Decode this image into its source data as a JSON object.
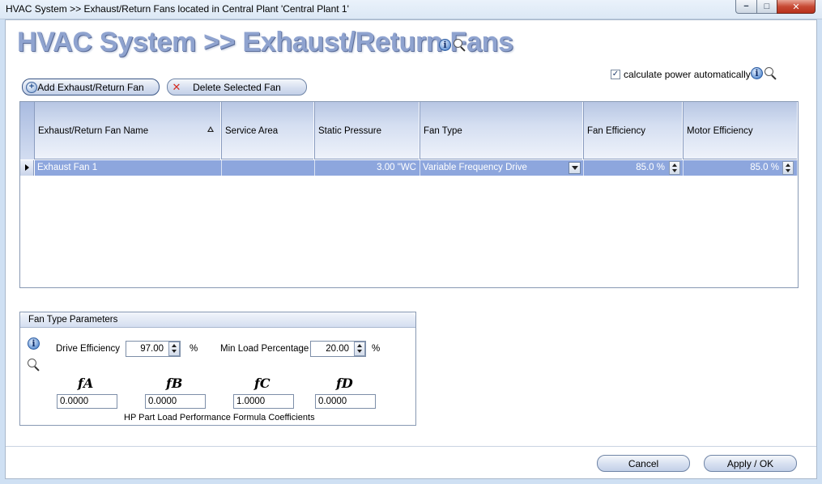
{
  "window": {
    "title": "HVAC System >> Exhaust/Return Fans located in Central Plant 'Central Plant 1'",
    "controls": {
      "minimize": "−",
      "maximize": "□",
      "close": "✕"
    }
  },
  "header": {
    "title": "HVAC System >> Exhaust/Return Fans"
  },
  "options": {
    "calculate_power_label": "calculate power automatically",
    "calculate_power_checked": "✓"
  },
  "toolbar": {
    "add_label": "Add Exhaust/Return Fan",
    "delete_label": "Delete Selected Fan"
  },
  "grid": {
    "columns": [
      "Exhaust/Return Fan Name",
      "Service Area",
      "Static Pressure",
      "Fan Type",
      "Fan Efficiency",
      "Motor Efficiency"
    ],
    "rows": [
      {
        "name": "Exhaust Fan 1",
        "service_area": "",
        "static_pressure": "3.00 \"WC",
        "fan_type": "Variable Frequency Drive",
        "fan_efficiency": "85.0 %",
        "motor_efficiency": "85.0 %"
      }
    ]
  },
  "fan_params": {
    "title": "Fan Type Parameters",
    "drive_efficiency_label": "Drive Efficiency",
    "drive_efficiency_value": "97.00",
    "drive_efficiency_unit": "%",
    "min_load_label": "Min Load Percentage",
    "min_load_value": "20.00",
    "min_load_unit": "%",
    "coefficients": [
      {
        "label": "fA",
        "value": "0.0000"
      },
      {
        "label": "fB",
        "value": "0.0000"
      },
      {
        "label": "fC",
        "value": "1.0000"
      },
      {
        "label": "fD",
        "value": "0.0000"
      }
    ],
    "caption": "HP Part Load Performance Formula Coefficients"
  },
  "footer": {
    "cancel_label": "Cancel",
    "ok_label": "Apply / OK"
  },
  "icons": [
    "info-icon",
    "magnifier-icon",
    "add-icon",
    "delete-x-icon",
    "sort-ascending-icon",
    "dropdown-arrow-icon",
    "spinner-icon",
    "row-selector-arrow-icon"
  ]
}
